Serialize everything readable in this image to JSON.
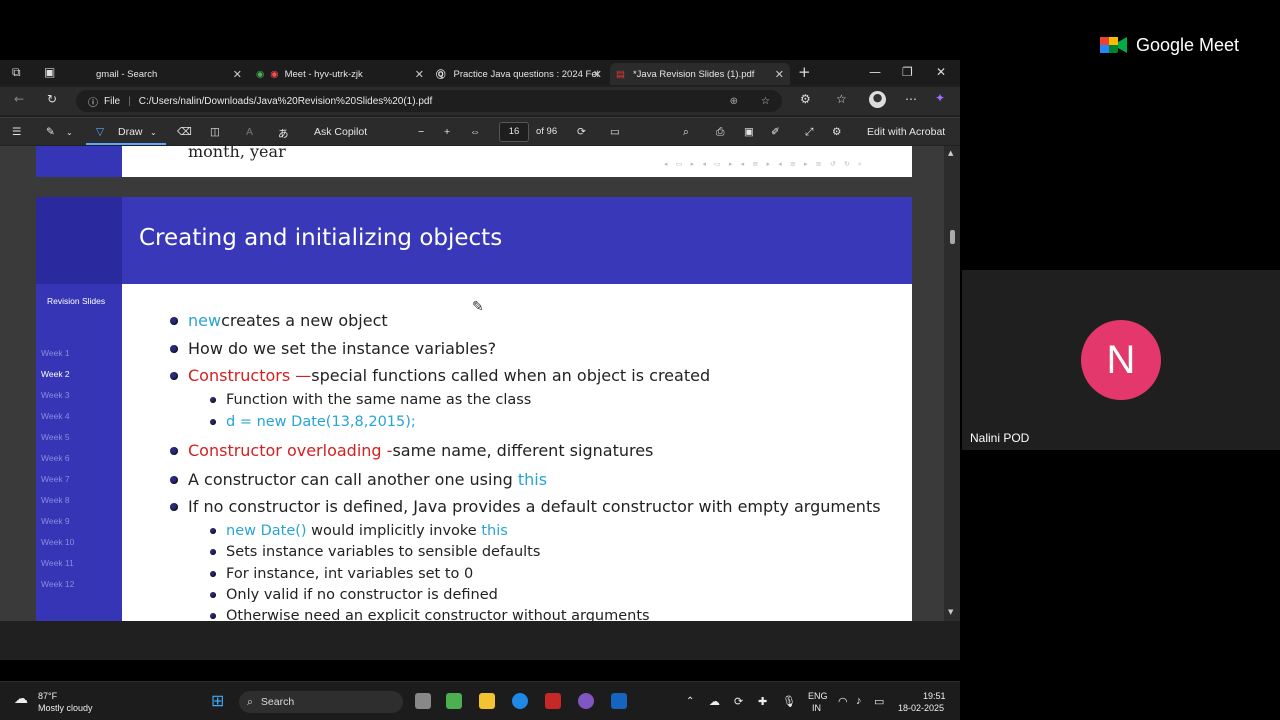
{
  "meet": {
    "logo_text": "Google Meet",
    "avatar_initial": "N",
    "participant_name": "Nalini POD"
  },
  "tabs": [
    {
      "label": "gmail - Search"
    },
    {
      "label": "Meet - hyv-utrk-zjk"
    },
    {
      "label": "Practice Java questions : 2024 Fel"
    },
    {
      "label": "*Java Revision Slides (1).pdf"
    }
  ],
  "address": {
    "prefix": "File",
    "url": "C:/Users/nalin/Downloads/Java%20Revision%20Slides%20(1).pdf"
  },
  "pdf_toolbar": {
    "draw": "Draw",
    "ask_copilot": "Ask Copilot",
    "page_current": "16",
    "page_total": "of 96",
    "edit_acrobat": "Edit with Acrobat"
  },
  "prev_slide": {
    "text": "month, year"
  },
  "slide": {
    "title": "Creating and initializing objects",
    "sidebar_title": "Revision Slides",
    "weeks": [
      "Week 1",
      "Week 2",
      "Week 3",
      "Week 4",
      "Week 5",
      "Week 6",
      "Week 7",
      "Week 8",
      "Week 9",
      "Week 10",
      "Week 11",
      "Week 12"
    ],
    "b1_kw": "new",
    "b1_rest": " creates a new object",
    "b2": "How do we set the instance variables?",
    "b3_kw": "Constructors —",
    "b3_rest": " special functions called when an object is created",
    "b3a": "Function with the same name as the class",
    "b3b": "d = new Date(13,8,2015);",
    "b4_kw": "Constructor overloading -",
    "b4_rest": " same name, different signatures",
    "b5_pre": "A constructor can call another one using ",
    "b5_kw": "this",
    "b6": "If no constructor is defined, Java provides a default constructor with empty arguments",
    "b6a_kw": "new Date()",
    "b6a_mid": " would implicitly invoke ",
    "b6a_kw2": "this",
    "b6b": "Sets instance variables to sensible defaults",
    "b6c": "For instance, int variables set to 0",
    "b6d": "Only valid if no constructor is defined",
    "b6e": "Otherwise need an explicit constructor without arguments"
  },
  "taskbar": {
    "temp": "87°F",
    "weather": "Mostly cloudy",
    "search": "Search",
    "lang1": "ENG",
    "lang2": "IN",
    "time": "19:51",
    "date": "18-02-2025"
  }
}
